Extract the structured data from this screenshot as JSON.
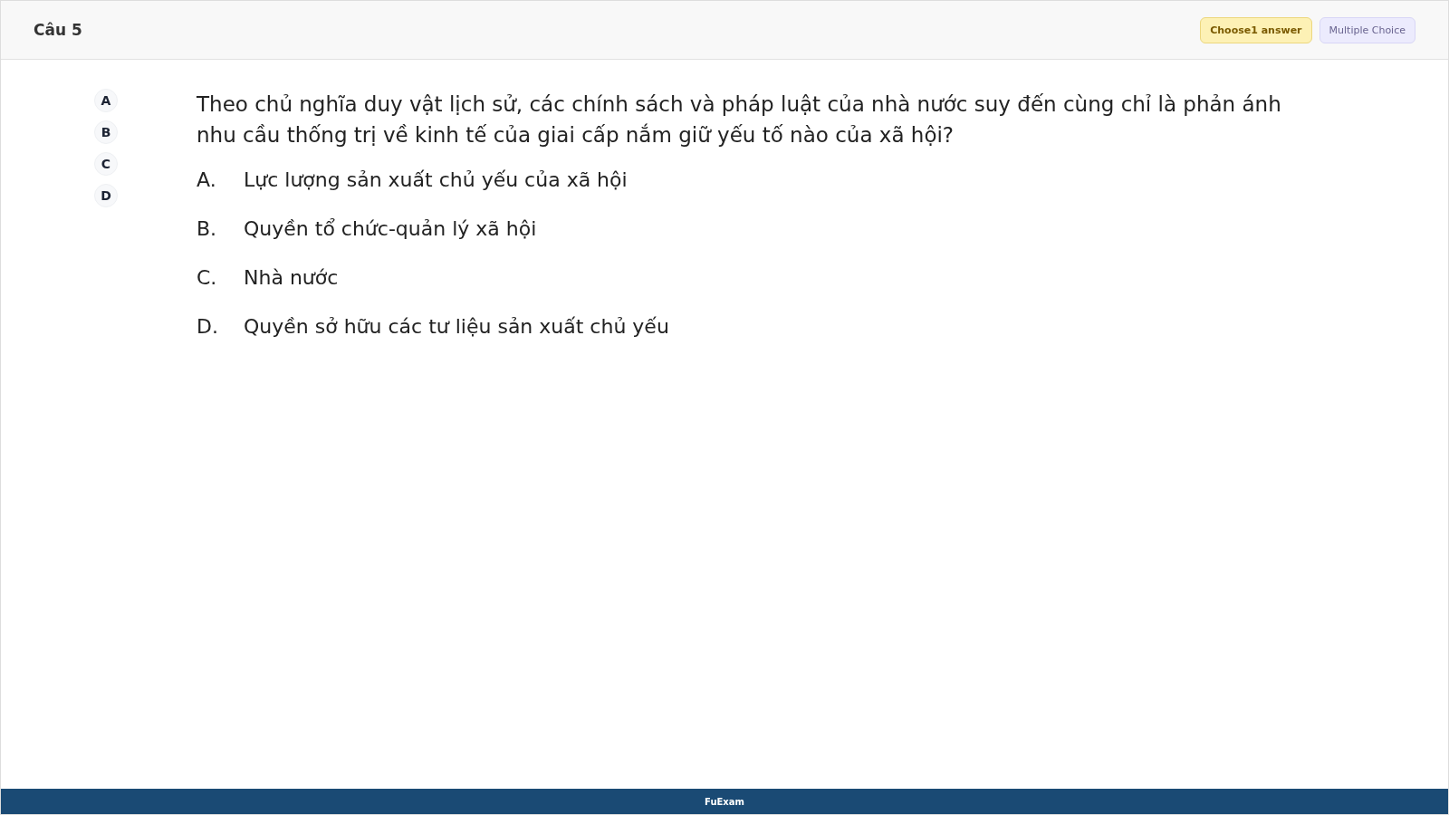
{
  "header": {
    "title": "Câu 5",
    "badges": [
      {
        "label": "Choose1 answer",
        "kind": "count"
      },
      {
        "label": "Multiple Choice",
        "kind": "type"
      }
    ]
  },
  "answer_buttons": [
    "A",
    "B",
    "C",
    "D"
  ],
  "question": "Theo chủ nghĩa duy vật lịch sử, các chính sách và pháp luật của nhà nước suy đến cùng chỉ là phản ánh nhu cầu thống trị về kinh tế của giai cấp nắm giữ yếu tố nào của xã hội?",
  "options": [
    {
      "letter": "A.",
      "text": "Lực lượng sản xuất chủ yếu của xã hội"
    },
    {
      "letter": "B.",
      "text": "Quyền tổ chức-quản lý xã hội"
    },
    {
      "letter": "C.",
      "text": "Nhà nước"
    },
    {
      "letter": "D.",
      "text": "Quyền sở hữu các tư liệu sản xuất chủ yếu"
    }
  ],
  "footer": {
    "text": "FuExam"
  }
}
